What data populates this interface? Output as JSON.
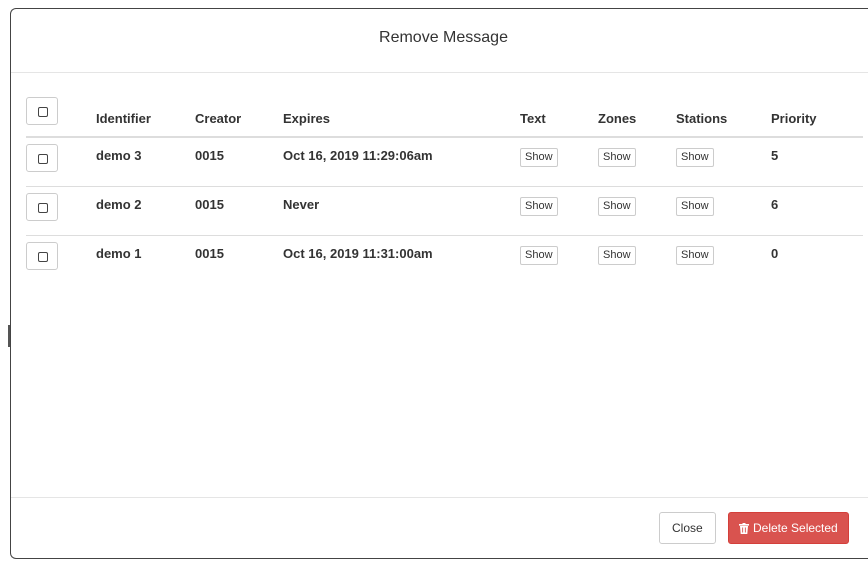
{
  "modal": {
    "title": "Remove Message"
  },
  "table": {
    "columns": [
      "Identifier",
      "Creator",
      "Expires",
      "Text",
      "Zones",
      "Stations",
      "Priority"
    ],
    "rows": [
      {
        "identifier": "demo 3",
        "creator": "0015",
        "expires": "Oct 16, 2019 11:29:06am",
        "text": "Show",
        "zones": "Show",
        "stations": "Show",
        "priority": "5"
      },
      {
        "identifier": "demo 2",
        "creator": "0015",
        "expires": "Never",
        "text": "Show",
        "zones": "Show",
        "stations": "Show",
        "priority": "6"
      },
      {
        "identifier": "demo 1",
        "creator": "0015",
        "expires": "Oct 16, 2019 11:31:00am",
        "text": "Show",
        "zones": "Show",
        "stations": "Show",
        "priority": "0"
      }
    ]
  },
  "footer": {
    "close_label": "Close",
    "delete_label": "Delete Selected"
  },
  "icons": {
    "delete": "trash-icon",
    "select": "checkbox-icon"
  },
  "colors": {
    "danger": "#d9534f",
    "border": "#dddddd",
    "text": "#333333"
  }
}
